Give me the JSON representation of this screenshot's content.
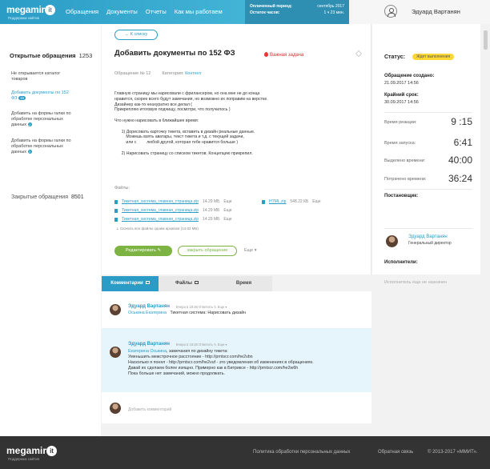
{
  "header": {
    "logo_text": "megamir",
    "logo_it": "it",
    "logo_sub": "Поддержка сайтов",
    "nav": [
      "Обращения",
      "Документы",
      "Отчеты",
      "Как мы работаем"
    ],
    "period_label": "Оплаченный период:",
    "period_value": "сентябрь 2017",
    "remain_label": "Остаток часов:",
    "remain_value": "1 ч 23 мин.",
    "user_name": "Эдуард Вартанян"
  },
  "sidebar": {
    "open_title": "Открытые обращения",
    "open_count": "1253",
    "items": [
      {
        "label": "Не открывается каталог товаров"
      },
      {
        "label": "Добавить документы по 152 ФЗ",
        "badge": "15"
      },
      {
        "label": "Добавить на формы галки по обработке персональных данных",
        "badge": "1"
      },
      {
        "label": "Добавить на формы галки по обработке персональных данных",
        "badge": "2"
      }
    ],
    "closed_title": "Закрытые обращения",
    "closed_count": "8501"
  },
  "ticket": {
    "back_label": "К списку",
    "title": "Добавить документы по 152 ФЗ",
    "important": "Важная задача",
    "number": "Обращение № 12",
    "category_label": "Категория:",
    "category_value": "Контент",
    "description": "Главную страницу мы нарисовали с фрилансером, но она мне не до конца\nнравится, скорее всего будут замечания, но возможно их поправим на верстке.\nДизайнер как-то неахуратно все делал (\nПрикрепляю итоговую подчищу, посмотри, что получилось )\n\nЧто нужно нарисовать в ближайшее время:\n\n      1) Дорисовать карточку тикета, вставить в дизайн реальные данные.\n          Можешь взять аватары, текст тикета и т.д. с текущей задачи,\n          или с         любой другой, которая тебе нравится больше )\n\n      2) Нарисовать страницу со списком тикетов. Концепцию прикрепил.",
    "files_title": "Файлы:",
    "files": [
      {
        "name": "Тикетная_система_главная_страница.zip",
        "size": "14.29 МБ",
        "more": "Еще"
      },
      {
        "name": "HTML.zip",
        "size": "548.22 КБ",
        "more": "Еще"
      },
      {
        "name": "Тикетная_система_главная_страница.zip",
        "size": "14.29 МБ",
        "more": "Еще"
      },
      {
        "name": "Тикетная_система_главная_страница.zip",
        "size": "14.29 МБ",
        "more": "Еще"
      }
    ],
    "download_all": "Скачать все файлы одним архивом (14.83 МБ)",
    "edit_label": "Редактировать",
    "close_label": "закрыть обращение",
    "more_label": "Еще"
  },
  "status": {
    "title": "Статус:",
    "badge": "Ждет выполнения",
    "created_label": "Обращение создано:",
    "created_value": "21.09.2017   14:56",
    "deadline_label": "Крайний срок:",
    "deadline_value": "30.09.2017   14:56",
    "rows": [
      {
        "label": "Время реакции:",
        "value": "9 :15"
      },
      {
        "label": "Время запуска:",
        "value": "6:41"
      },
      {
        "label": "Выделено времени:",
        "value": "40:00"
      },
      {
        "label": "Потрачено времени:",
        "value": "36:24"
      }
    ],
    "poster_title": "Постановщик:",
    "poster_name": "Эдуард Вартанян",
    "poster_role": "Генеральный директор",
    "executors_title": "Исполнители:",
    "executors_empty": "Исполнитель еще не назначен"
  },
  "tabs": [
    "Комментарии",
    "Файлы",
    "Время"
  ],
  "comments": [
    {
      "author": "Эдуард Вартанян",
      "meta": "Вчера в 18:26   Ответить ↻   Еще ▾",
      "ref": "Оськина Екатерина",
      "body": "Тикетная система: Нарисовать дизайн"
    },
    {
      "author": "Эдуард Вартанян",
      "meta": "Вчера в 18:26   Ответить ↻   Еще ▾",
      "ref": "Екатерина Оськина",
      "body_first": ", замечания по дизайну тикета:",
      "body": "Уменьшить межстрочное расстояние - http://prntscr.com/he2vbn\nНасколько я понял - http://prntscr.com/he2vuf - это уведомления об изменениях в обращениях.\nДавай их сделаем более изящно. Примерно как в Битриксе - http://prntscr.com/he2w6h\nПока больше нет замечаний, можно продолжать."
    }
  ],
  "add_comment": "Добавить комментарий",
  "footer": {
    "logo_text": "megamir",
    "logo_it": "it",
    "logo_sub": "Поддержка сайтов",
    "policy": "Политика обработки персональных данных",
    "feedback": "Обратная связь",
    "copyright": "© 2013-2017 «ММИТ»."
  }
}
